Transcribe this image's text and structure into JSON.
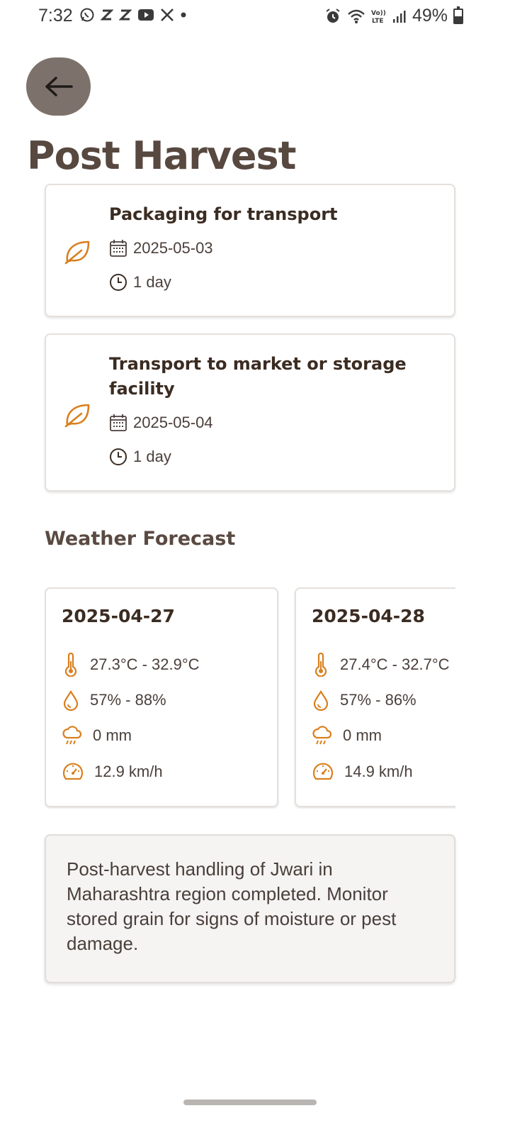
{
  "status_bar": {
    "time": "7:32",
    "battery": "49%",
    "left_icons": [
      "whatsapp-icon",
      "z-icon",
      "z-icon",
      "youtube-icon",
      "x-icon",
      "dot-icon"
    ],
    "right_icons": [
      "alarm-icon",
      "wifi-icon",
      "volte-icon",
      "signal-icon",
      "battery-icon"
    ]
  },
  "header": {
    "title": "Post Harvest"
  },
  "tasks": [
    {
      "title": "Packaging for transport",
      "date": "2025-05-03",
      "duration": "1 day"
    },
    {
      "title": "Transport to market or storage facility",
      "date": "2025-05-04",
      "duration": "1 day"
    }
  ],
  "weather": {
    "title": "Weather Forecast",
    "days": [
      {
        "date": "2025-04-27",
        "temperature": "27.3°C - 32.9°C",
        "humidity": "57% - 88%",
        "rain": "0 mm",
        "wind": "12.9 km/h"
      },
      {
        "date": "2025-04-28",
        "temperature": "27.4°C - 32.7°C",
        "humidity": "57% - 86%",
        "rain": "0 mm",
        "wind": "14.9 km/h"
      }
    ]
  },
  "note": {
    "text": "Post-harvest handling of Jwari in Maharashtra region completed. Monitor stored grain for signs of moisture or pest damage."
  },
  "colors": {
    "accent": "#d97f1e",
    "title": "#574840",
    "back_button": "#7d726b"
  }
}
